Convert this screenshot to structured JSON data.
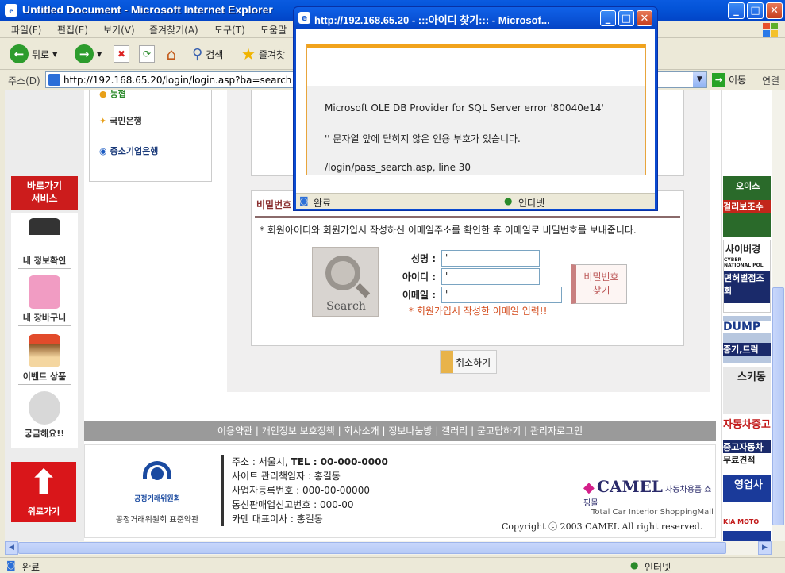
{
  "window": {
    "title": "Untitled Document - Microsoft Internet Explorer"
  },
  "menu": [
    "파일(F)",
    "편집(E)",
    "보기(V)",
    "즐겨찾기(A)",
    "도구(T)",
    "도움말"
  ],
  "toolbar": {
    "back": "뒤로",
    "search": "검색",
    "favorites": "즐겨찾"
  },
  "address": {
    "label": "주소(D)",
    "url": "http://192.168.65.20/login/login.asp?ba=search",
    "go": "이동",
    "links": "연결"
  },
  "status": {
    "left": "완료",
    "zone": "인터넷"
  },
  "banks": [
    "농협",
    "국민은행",
    "중소기업은행"
  ],
  "quick_service": "바로가기\n서비스",
  "quick_items": [
    "내 정보확인",
    "내 장바구니",
    "이벤트 상품",
    "궁금해요!!"
  ],
  "top_button": "위로가기",
  "pw_section": {
    "title": "비밀번호",
    "desc": "* 회원아이디와 회원가입시 작성하신 이메일주소를 확인한 후 이메일로 비밀번호를 보내줍니다.",
    "search_img_text": "Search",
    "fields": [
      {
        "label": "성명 :",
        "value": "'"
      },
      {
        "label": "아이디 :",
        "value": "'"
      },
      {
        "label": "이메일 :",
        "value": "'"
      }
    ],
    "hint": "* 회원가입시 작성한 이메일 입력!!",
    "find_button": "비밀번호\n찾기",
    "cancel": "취소하기"
  },
  "footer_nav": "이용약관 | 개인정보 보호정책 | 회사소개 | 정보나눔방 | 갤러리 | 묻고답하기 | 관리자로그인",
  "footer": {
    "ftc_logo_text": "공정거래위원회",
    "ftc_caption": "공정거래위원회 표준약관",
    "address": "주소 : 서울시,",
    "tel": "TEL : 00-000-0000",
    "manager": "사이트 관리책임자 : 홍길동",
    "biz_no": "사업자등록번호 : 000-00-00000",
    "mail_order": "통신판매업신고번호 : 000-00",
    "ceo": "카멘 대표이사 : 홍길동",
    "brand": "CAMEL",
    "brand_kr": "자동차용품 쇼핑몰",
    "brand_sub": "Total Car Interior ShoppingMall",
    "copyright": "Copyright ⓒ 2003 CAMEL All right reserved."
  },
  "right_ads": [
    "오이스",
    "걸리보조수",
    "사이버경",
    "CYBER NATIONAL POL",
    "면허벌점조회",
    "DUMP",
    "중기,트럭",
    "스키동",
    "자동차중고",
    "중고자동차",
    "무료견적",
    "영업사",
    "KIA MOTO"
  ],
  "popup": {
    "title": "http://192.168.65.20 - :::아이디 찾기::: - Microsof...",
    "error1": "Microsoft OLE DB Provider for SQL Server error '80040e14'",
    "error2": "'' 문자열 앞에 닫히지 않은 인용 부호가 있습니다.",
    "error3": "/login/pass_search.asp, line 30",
    "status_left": "완료",
    "status_zone": "인터넷"
  }
}
